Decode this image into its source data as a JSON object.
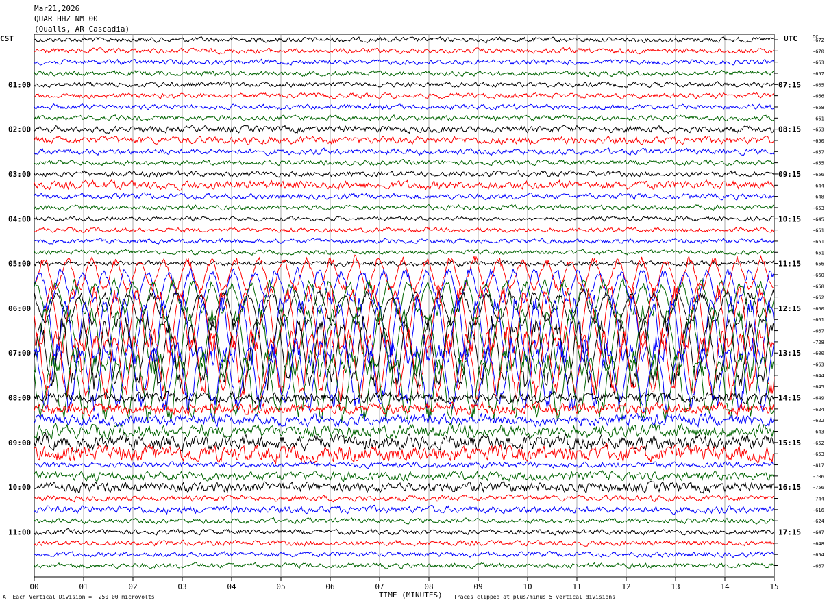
{
  "header": {
    "date": "Mar21,2026",
    "station": "QUAR HHZ NM 00",
    "location": "(Qualls, AR Cascadia)"
  },
  "left_tz": "CST",
  "right_tz": "UTC",
  "dc_label": "DC",
  "footer": {
    "scale": "Each Vertical Division =  250.00 microvolts",
    "clip": "Traces clipped at plus/minus 5 vertical divisions",
    "corner": "A"
  },
  "chart_data": {
    "type": "line",
    "title": "QUAR HHZ NM 00",
    "xlabel": "TIME (MINUTES)",
    "x_ticks": [
      "00",
      "01",
      "02",
      "03",
      "04",
      "05",
      "06",
      "07",
      "08",
      "09",
      "10",
      "11",
      "12",
      "13",
      "14",
      "15"
    ],
    "xlim": [
      0,
      15
    ],
    "trace_minutes": 15,
    "colors": [
      "#000000",
      "#ff0000",
      "#0000ff",
      "#006400"
    ],
    "left_hour_labels": [
      "01:00",
      "02:00",
      "03:00",
      "04:00",
      "05:00",
      "06:00",
      "07:00",
      "08:00",
      "09:00",
      "10:00",
      "11:00"
    ],
    "right_hour_labels": [
      "07:15",
      "08:15",
      "09:15",
      "10:15",
      "11:15",
      "12:15",
      "13:15",
      "14:15",
      "15:15",
      "16:15",
      "17:15"
    ],
    "dc_offsets": [
      -672,
      -670,
      -663,
      -657,
      -665,
      -666,
      -658,
      -661,
      -653,
      -650,
      -657,
      -655,
      -656,
      -644,
      -648,
      -653,
      -645,
      -651,
      -651,
      -651,
      -656,
      -660,
      -658,
      -662,
      -660,
      -661,
      -667,
      -728,
      -600,
      -663,
      -644,
      -645,
      -649,
      -624,
      -622,
      -643,
      -652,
      -653,
      -817,
      -706,
      -756,
      -744,
      -616,
      -624,
      -647,
      -648,
      -654,
      -667
    ],
    "trace_amplitudes": [
      0.35,
      0.35,
      0.35,
      0.35,
      0.35,
      0.35,
      0.35,
      0.35,
      0.45,
      0.5,
      0.4,
      0.35,
      0.4,
      0.6,
      0.4,
      0.35,
      0.3,
      0.3,
      0.3,
      0.3,
      0.35,
      0.3,
      0.3,
      0.3,
      0.3,
      0.3,
      0.3,
      0.3,
      0.6,
      0.6,
      0.6,
      0.6,
      0.7,
      0.8,
      0.8,
      0.9,
      1.0,
      1.1,
      0.4,
      0.6,
      0.7,
      0.4,
      0.5,
      0.35,
      0.35,
      0.35,
      0.35,
      0.35
    ]
  }
}
